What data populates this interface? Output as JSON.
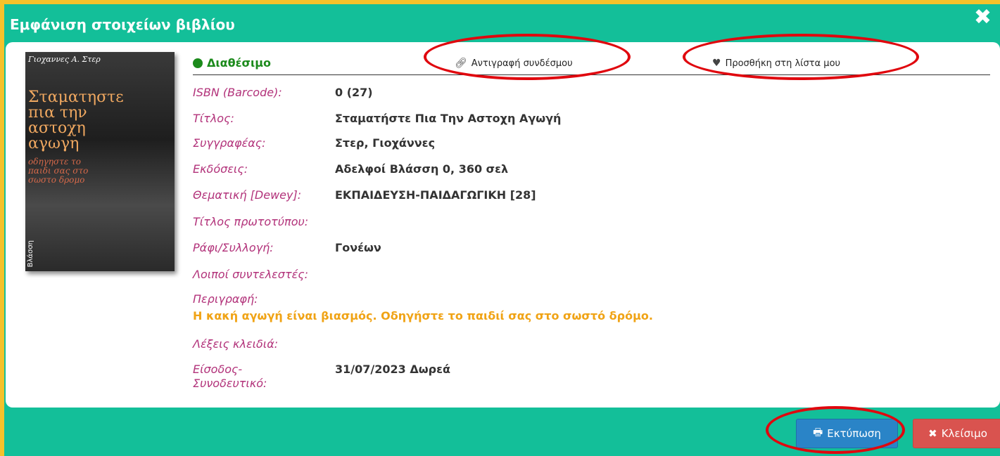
{
  "dialog": {
    "title": "Εμφάνιση στοιχείων βιβλίου",
    "close_icon": "✖"
  },
  "cover": {
    "author_text": "Γιοχαννες Α. Στερ",
    "title_text": "Σταματηστε πια την αστοχη αγωγη",
    "subtitle_text": "οδηγηστε το παιδι σας στο σωστο δρομο",
    "publisher_text": "Βλάσση"
  },
  "status": {
    "availability": "Διαθέσιμο",
    "availability_color": "#1b8a1b",
    "copy_link_label": "Αντιγραφή συνδέσμου",
    "add_list_label": "Προσθήκη στη λίστα μου"
  },
  "fields": [
    {
      "label": "ISBN (Barcode):",
      "value": "0 (27)"
    },
    {
      "label": "Τίτλος:",
      "value": "Σταματήστε Πια Την Αστοχη Αγωγή"
    },
    {
      "label": "Συγγραφέας:",
      "value": "Στερ, Γιοχάννες"
    },
    {
      "label": "Εκδόσεις:",
      "value": "Αδελφοί Βλάσση 0, 360 σελ"
    },
    {
      "label": "Θεματική [Dewey]:",
      "value": "ΕΚΠΑΙΔΕΥΣΗ-ΠΑΙΔΑΓΩΓΙΚΗ [28]"
    },
    {
      "label": "Τίτλος πρωτοτύπου:",
      "value": ""
    },
    {
      "label": "Ράφι/Συλλογή:",
      "value": "Γονέων"
    },
    {
      "label": "Λοιποί συντελεστές:",
      "value": ""
    },
    {
      "label": "Περιγραφή:",
      "value": ""
    },
    {
      "label": "Λέξεις κλειδιά:",
      "value": ""
    },
    {
      "label": "Είσοδος-Συνοδευτικό:",
      "value": "31/07/2023 Δωρεά"
    }
  ],
  "description": "Η κακή αγωγή είναι βιασμός. Οδηγήστε το παιδιί σας στο σωστό δρόμο.",
  "entry_label_line1": "Είσοδος-",
  "entry_label_line2": "Συνοδευτικό:",
  "footer": {
    "print_label": "Εκτύπωση",
    "close_label": "Κλείσιμο"
  },
  "colors": {
    "header_bg": "#13bf99",
    "label_color": "#b2327a",
    "description_color": "#f0a315",
    "print_button": "#2a84c7",
    "close_button": "#d9534f",
    "annotation_ring": "#e0070e"
  }
}
